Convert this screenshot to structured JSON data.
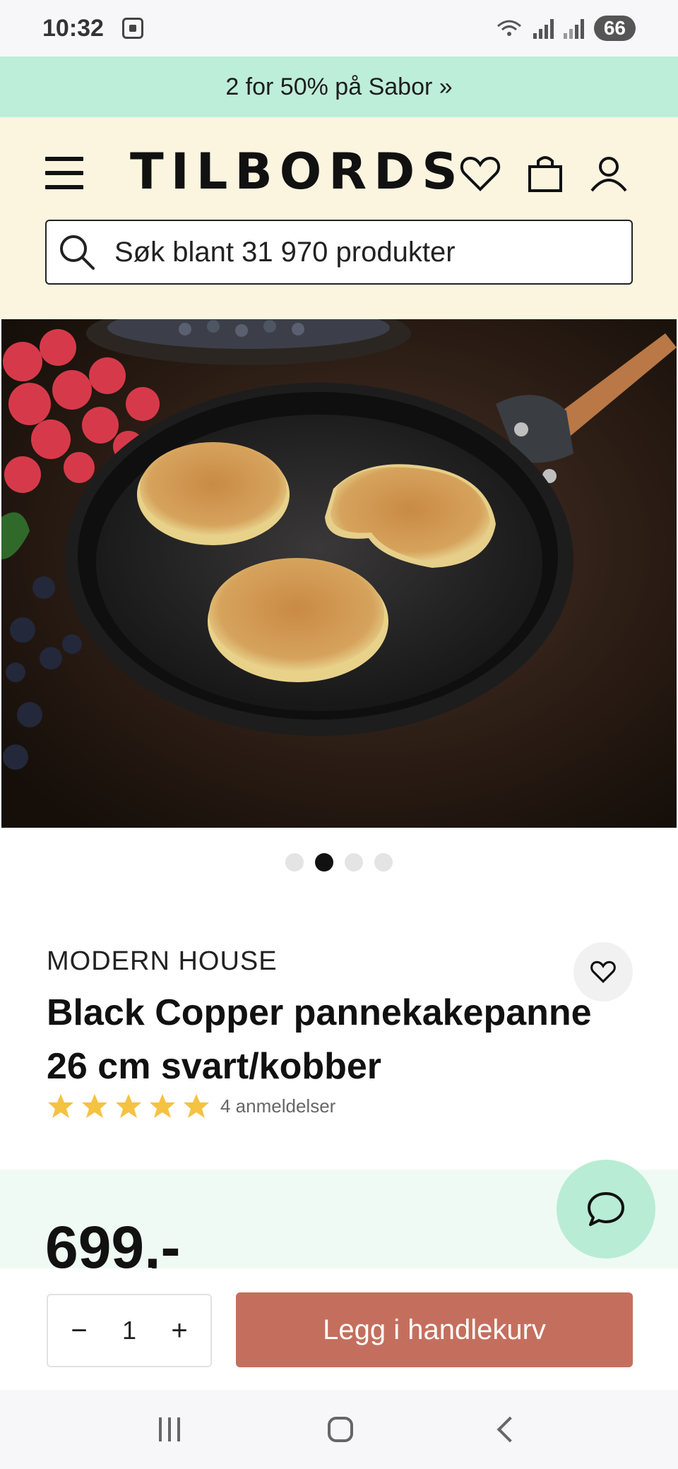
{
  "status_bar": {
    "time": "10:32",
    "battery": "66"
  },
  "promo": {
    "text": "2 for 50% på Sabor »"
  },
  "header": {
    "logo": "TILBORDS",
    "search_placeholder": "Søk blant 31 970 produkter"
  },
  "gallery": {
    "slide_count": 4,
    "active_index": 1
  },
  "product": {
    "brand": "MODERN HOUSE",
    "title": "Black Copper pannekakepanne 26 cm svart/kobber",
    "rating": 5,
    "reviews": "4 anmeldelser",
    "price": "699,-"
  },
  "purchase": {
    "quantity": "1",
    "minus": "−",
    "plus": "+",
    "add_to_cart": "Legg i handlekurv"
  },
  "colors": {
    "promo_bg": "#bdeed9",
    "header_bg": "#fbf5e0",
    "price_band_bg": "#effaf4",
    "chat_bg": "#b8ecd5",
    "cta_bg": "#c46f5e",
    "star": "#f5c242"
  }
}
